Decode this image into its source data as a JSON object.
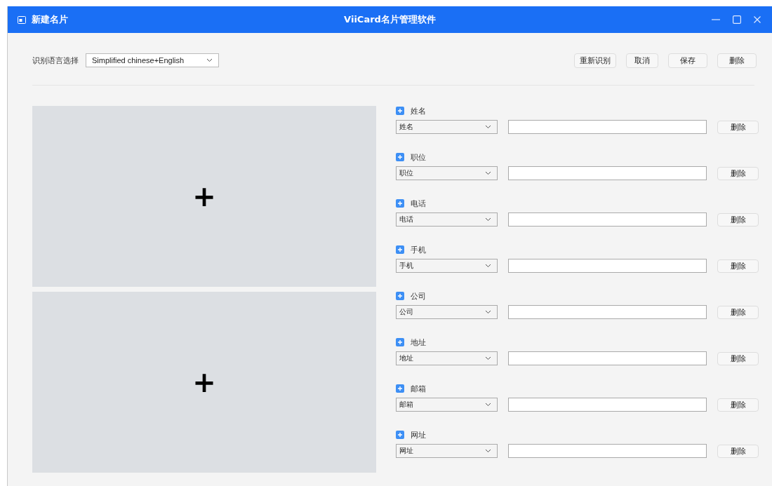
{
  "window": {
    "title": "新建名片",
    "app_title": "ViiCard名片管理软件"
  },
  "toolbar": {
    "language_label": "识别语言选择",
    "language_value": "Simplified chinese+English",
    "buttons": [
      "重新识别",
      "取消",
      "保存",
      "删除"
    ]
  },
  "card_images": [
    {
      "kind": "picture_slot",
      "icon": "+"
    },
    {
      "kind": "picture_slot",
      "icon": "+"
    }
  ],
  "fields": [
    {
      "label": "姓名",
      "type": "姓名",
      "delete": "删除"
    },
    {
      "label": "职位",
      "type": "职位",
      "delete": "删除"
    },
    {
      "label": "电话",
      "type": "电话",
      "delete": "删除"
    },
    {
      "label": "手机",
      "type": "手机",
      "delete": "删除"
    },
    {
      "label": "公司",
      "type": "公司",
      "delete": "删除"
    },
    {
      "label": "地址",
      "type": "地址",
      "delete": "删除"
    },
    {
      "label": "邮箱",
      "type": "邮箱",
      "delete": "删除"
    },
    {
      "label": "网址",
      "type": "网址",
      "delete": "删除"
    }
  ]
}
